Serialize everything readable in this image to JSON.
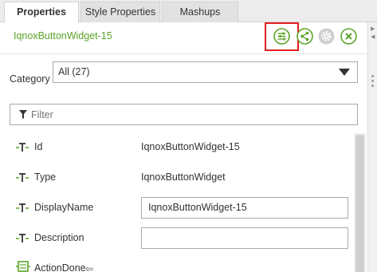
{
  "tabs": [
    {
      "label": "Properties"
    },
    {
      "label": "Style Properties"
    },
    {
      "label": "Mashups"
    }
  ],
  "header": {
    "widget_name": "IqnoxButtonWidget-15",
    "icons": [
      "sliders-icon",
      "share-icon",
      "gear-icon",
      "close-icon"
    ],
    "accent_color": "#5ba427",
    "highlight_color": "#e0201f"
  },
  "category": {
    "label": "Category",
    "selected": "All (27)"
  },
  "filter": {
    "placeholder": "Filter"
  },
  "properties": [
    {
      "name": "Id",
      "value": "IqnoxButtonWidget-15",
      "editable": false
    },
    {
      "name": "Type",
      "value": "IqnoxButtonWidget",
      "editable": false
    },
    {
      "name": "DisplayName",
      "value": "IqnoxButtonWidget-15",
      "editable": true
    },
    {
      "name": "Description",
      "value": "",
      "editable": true
    },
    {
      "name": "ActionDone",
      "value": "",
      "editable": false,
      "icon": "event-icon"
    }
  ]
}
